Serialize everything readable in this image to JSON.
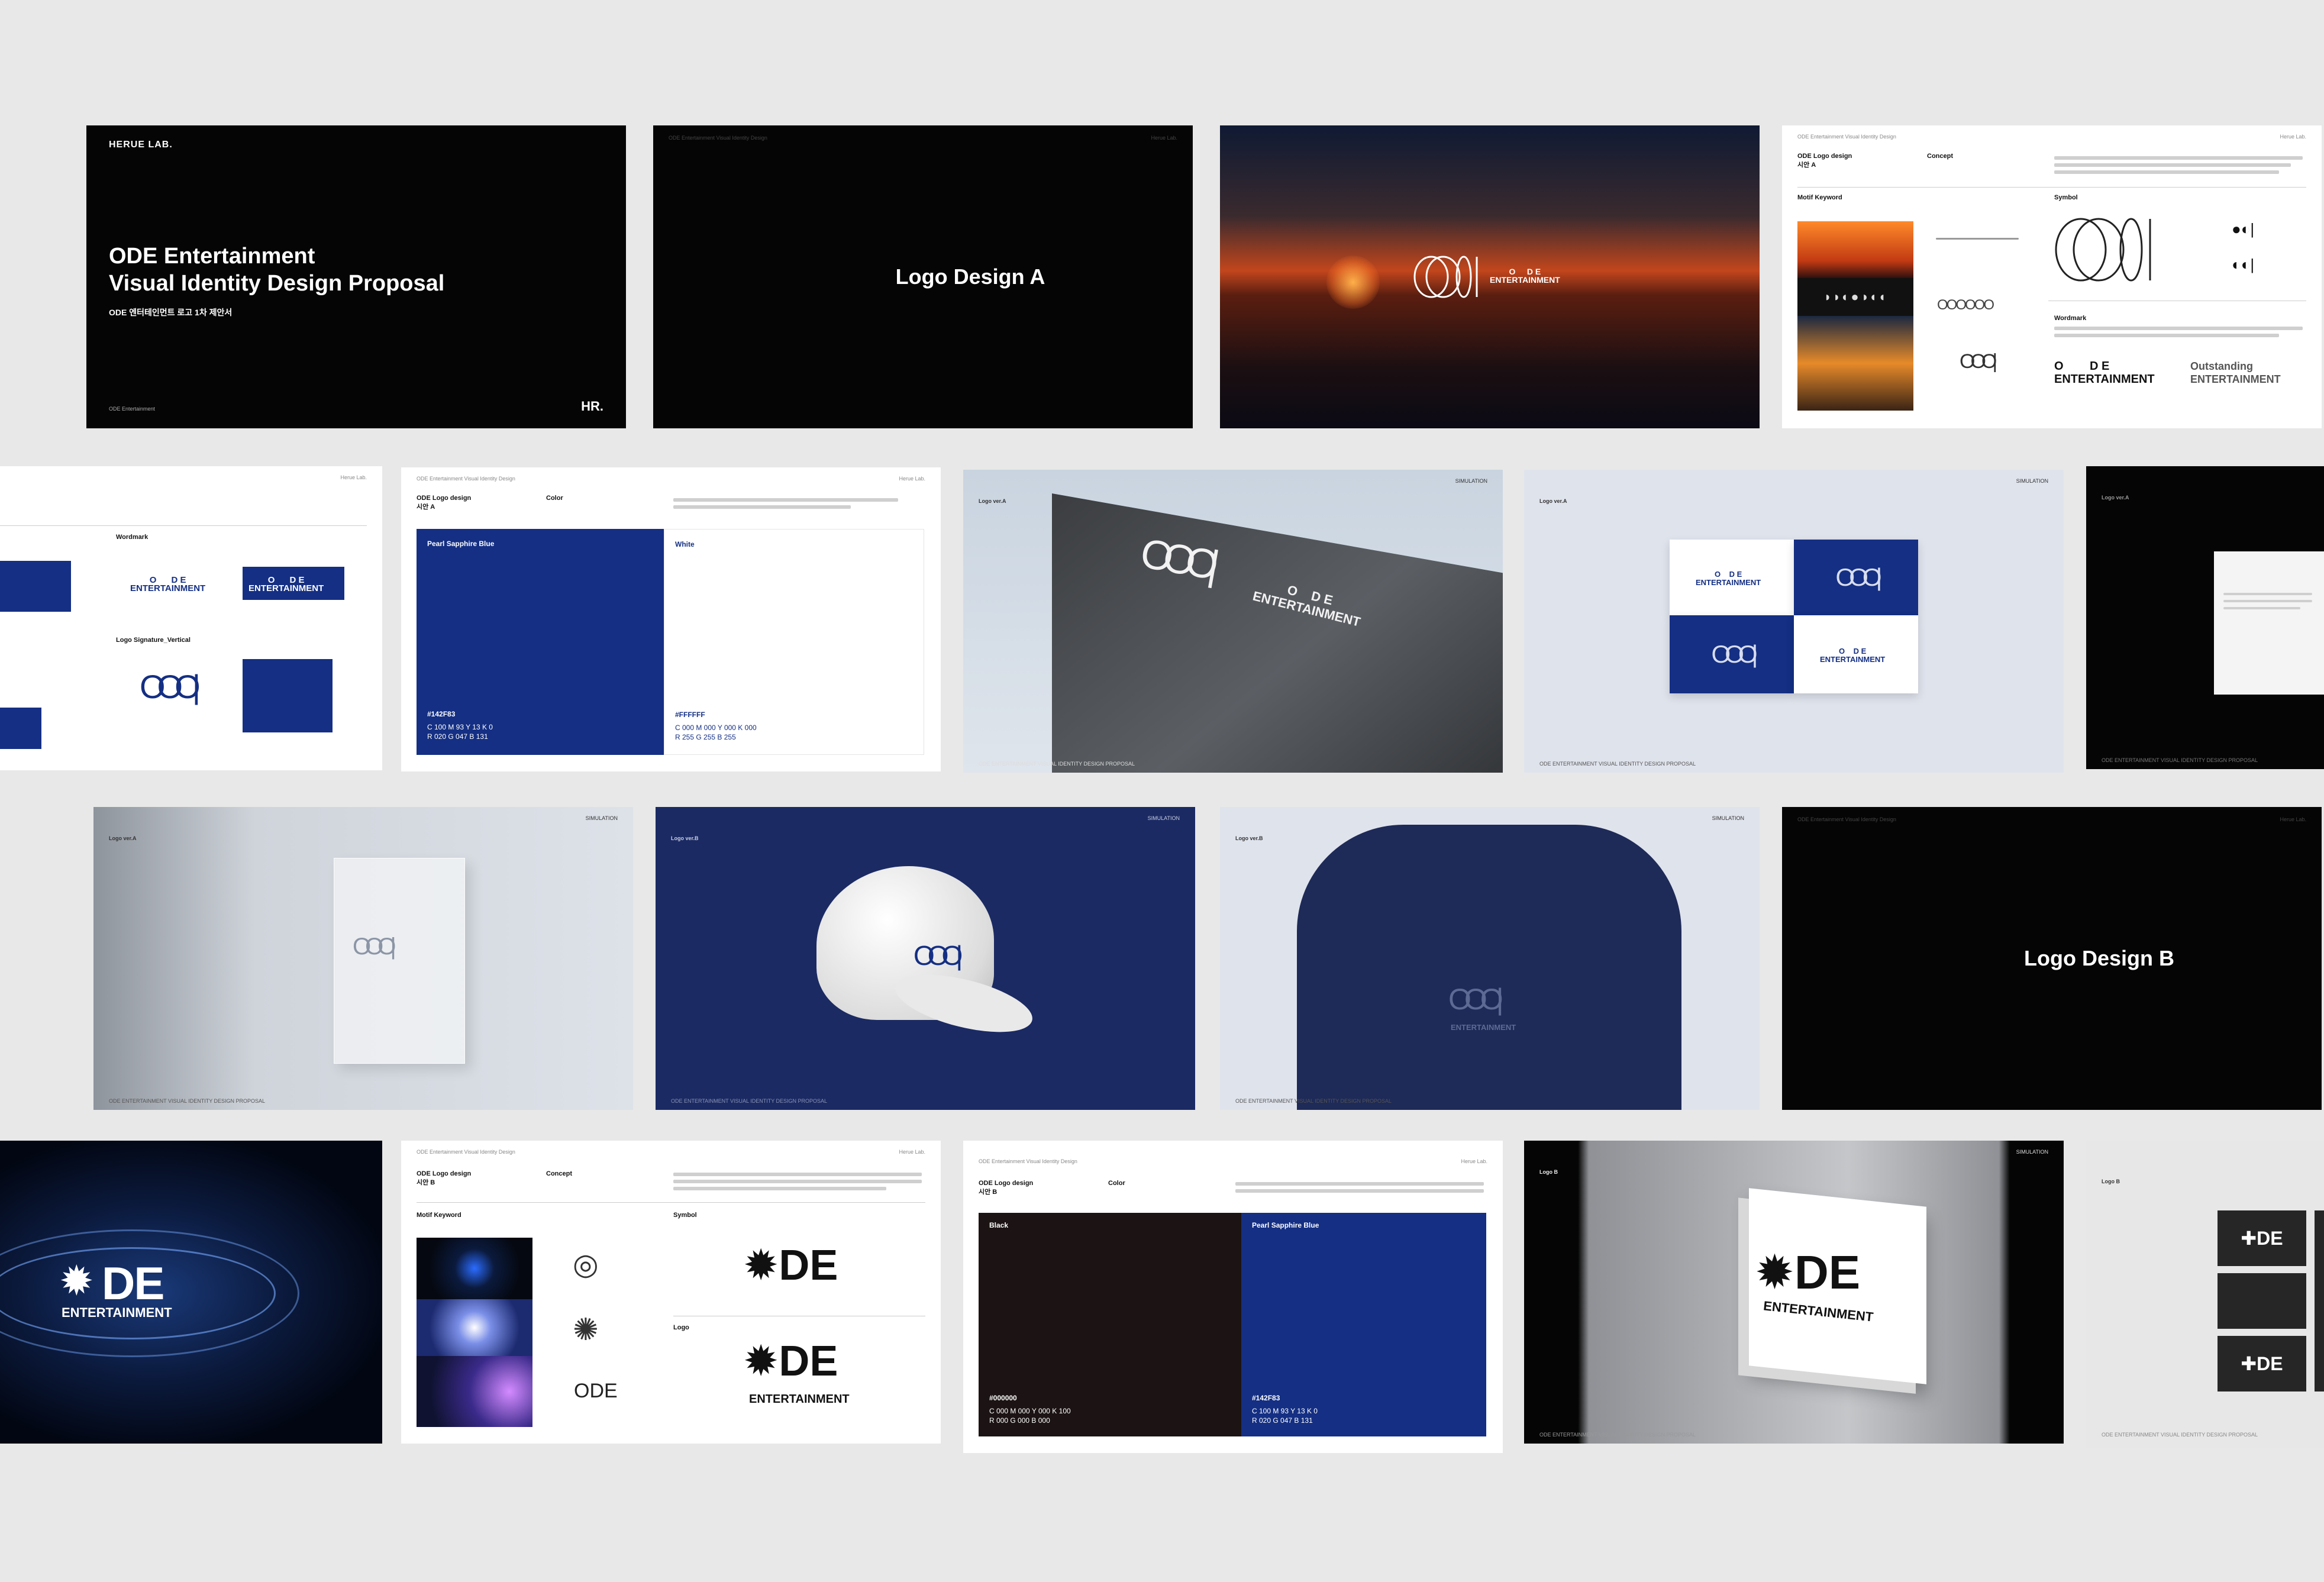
{
  "studio": {
    "logo_text": "HERUE LAB.",
    "mark": "HR.",
    "company": "ODE Entertainment"
  },
  "cover": {
    "title_line1": "ODE Entertainment",
    "title_line2": "Visual Identity Design Proposal",
    "subtitle": "ODE 엔터테인먼트 로고 1차 제안서"
  },
  "headers": {
    "series": "ODE Entertainment Visual Identity Design",
    "studio_small": "Herue Lab.",
    "simulation": "SIMULATION",
    "footer": "ODE ENTERTAINMENT VISUAL IDENTITY DESIGN PROPOSAL"
  },
  "sections": {
    "logo_a": "Logo Design A",
    "logo_b": "Logo Design B"
  },
  "labels": {
    "logo_design": "ODE Logo design",
    "plan_a": "시안 A",
    "plan_b": "시안 B",
    "concept": "Concept",
    "color": "Color",
    "motif_keyword": "Motif Keyword",
    "symbol": "Symbol",
    "wordmark": "Wordmark",
    "logo": "Logo",
    "logo_signature_vertical": "Logo Signature_Vertical",
    "logo_ver_a": "Logo ver.A",
    "logo_ver_b": "Logo ver.B",
    "logo_b": "Logo B"
  },
  "brand": {
    "o": "O",
    "de": "D E",
    "entertainment": "ENTERTAINMENT",
    "ode_word": "ODE",
    "de_logo": "DE",
    "outstanding": "Outstanding"
  },
  "colors": {
    "blue_name": "Pearl Sapphire Blue",
    "blue_hex": "#142F83",
    "blue_cmyk": "C 100  M 93  Y 13  K 0",
    "blue_rgb": "R 020  G 047  B 131",
    "white_name": "White",
    "white_hex": "#FFFFFF",
    "white_cmyk": "C 000  M 000  Y 000  K 000",
    "white_rgb": "R 255  G 255  B 255",
    "black_name": "Black",
    "black_hex": "#000000",
    "black_cmyk": "C 000  M 000  Y 000  K 100",
    "black_rgb": "R 000  G 000  B 000",
    "accent": "#142F83"
  }
}
